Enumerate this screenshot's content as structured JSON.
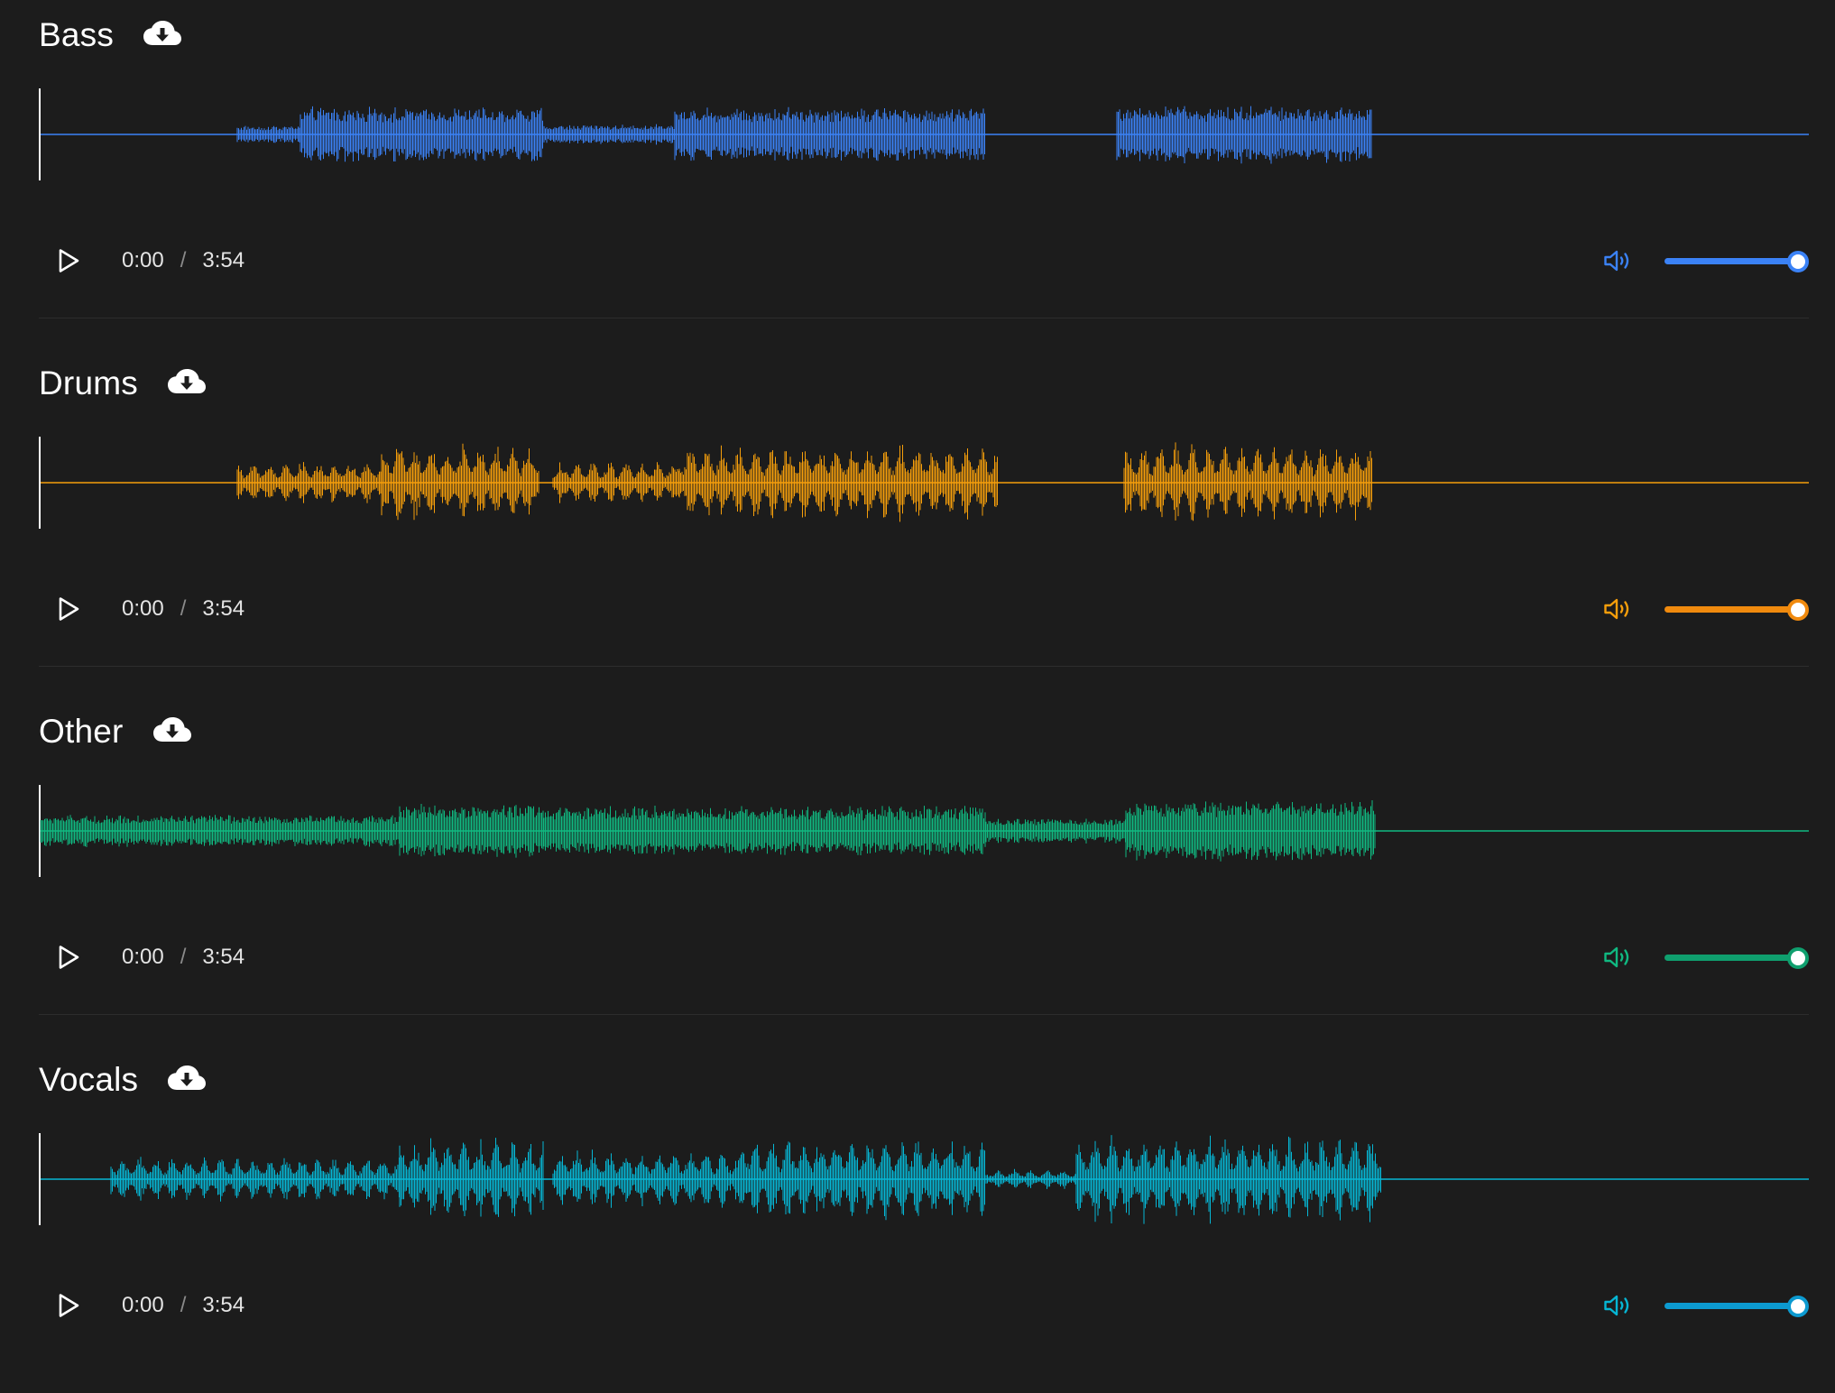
{
  "tracks": [
    {
      "id": "bass",
      "title": "Bass",
      "color": "#3b82f6",
      "current_time": "0:00",
      "separator": "/",
      "duration": "3:54",
      "volume": 1.0,
      "play_icon": "play-icon",
      "download_icon": "cloud-download-icon",
      "volume_icon": "speaker-volume-icon"
    },
    {
      "id": "drums",
      "title": "Drums",
      "color": "#f59e0b",
      "slider_color": "#f08a0e",
      "current_time": "0:00",
      "separator": "/",
      "duration": "3:54",
      "volume": 1.0,
      "play_icon": "play-icon",
      "download_icon": "cloud-download-icon",
      "volume_icon": "speaker-volume-icon"
    },
    {
      "id": "other",
      "title": "Other",
      "color": "#10b981",
      "slider_color": "#0f9f6e",
      "current_time": "0:00",
      "separator": "/",
      "duration": "3:54",
      "volume": 1.0,
      "play_icon": "play-icon",
      "download_icon": "cloud-download-icon",
      "volume_icon": "speaker-volume-icon"
    },
    {
      "id": "vocals",
      "title": "Vocals",
      "color": "#06b6d4",
      "slider_color": "#0c9ad0",
      "current_time": "0:00",
      "separator": "/",
      "duration": "3:54",
      "volume": 1.0,
      "play_icon": "play-icon",
      "download_icon": "cloud-download-icon",
      "volume_icon": "speaker-volume-icon"
    }
  ]
}
